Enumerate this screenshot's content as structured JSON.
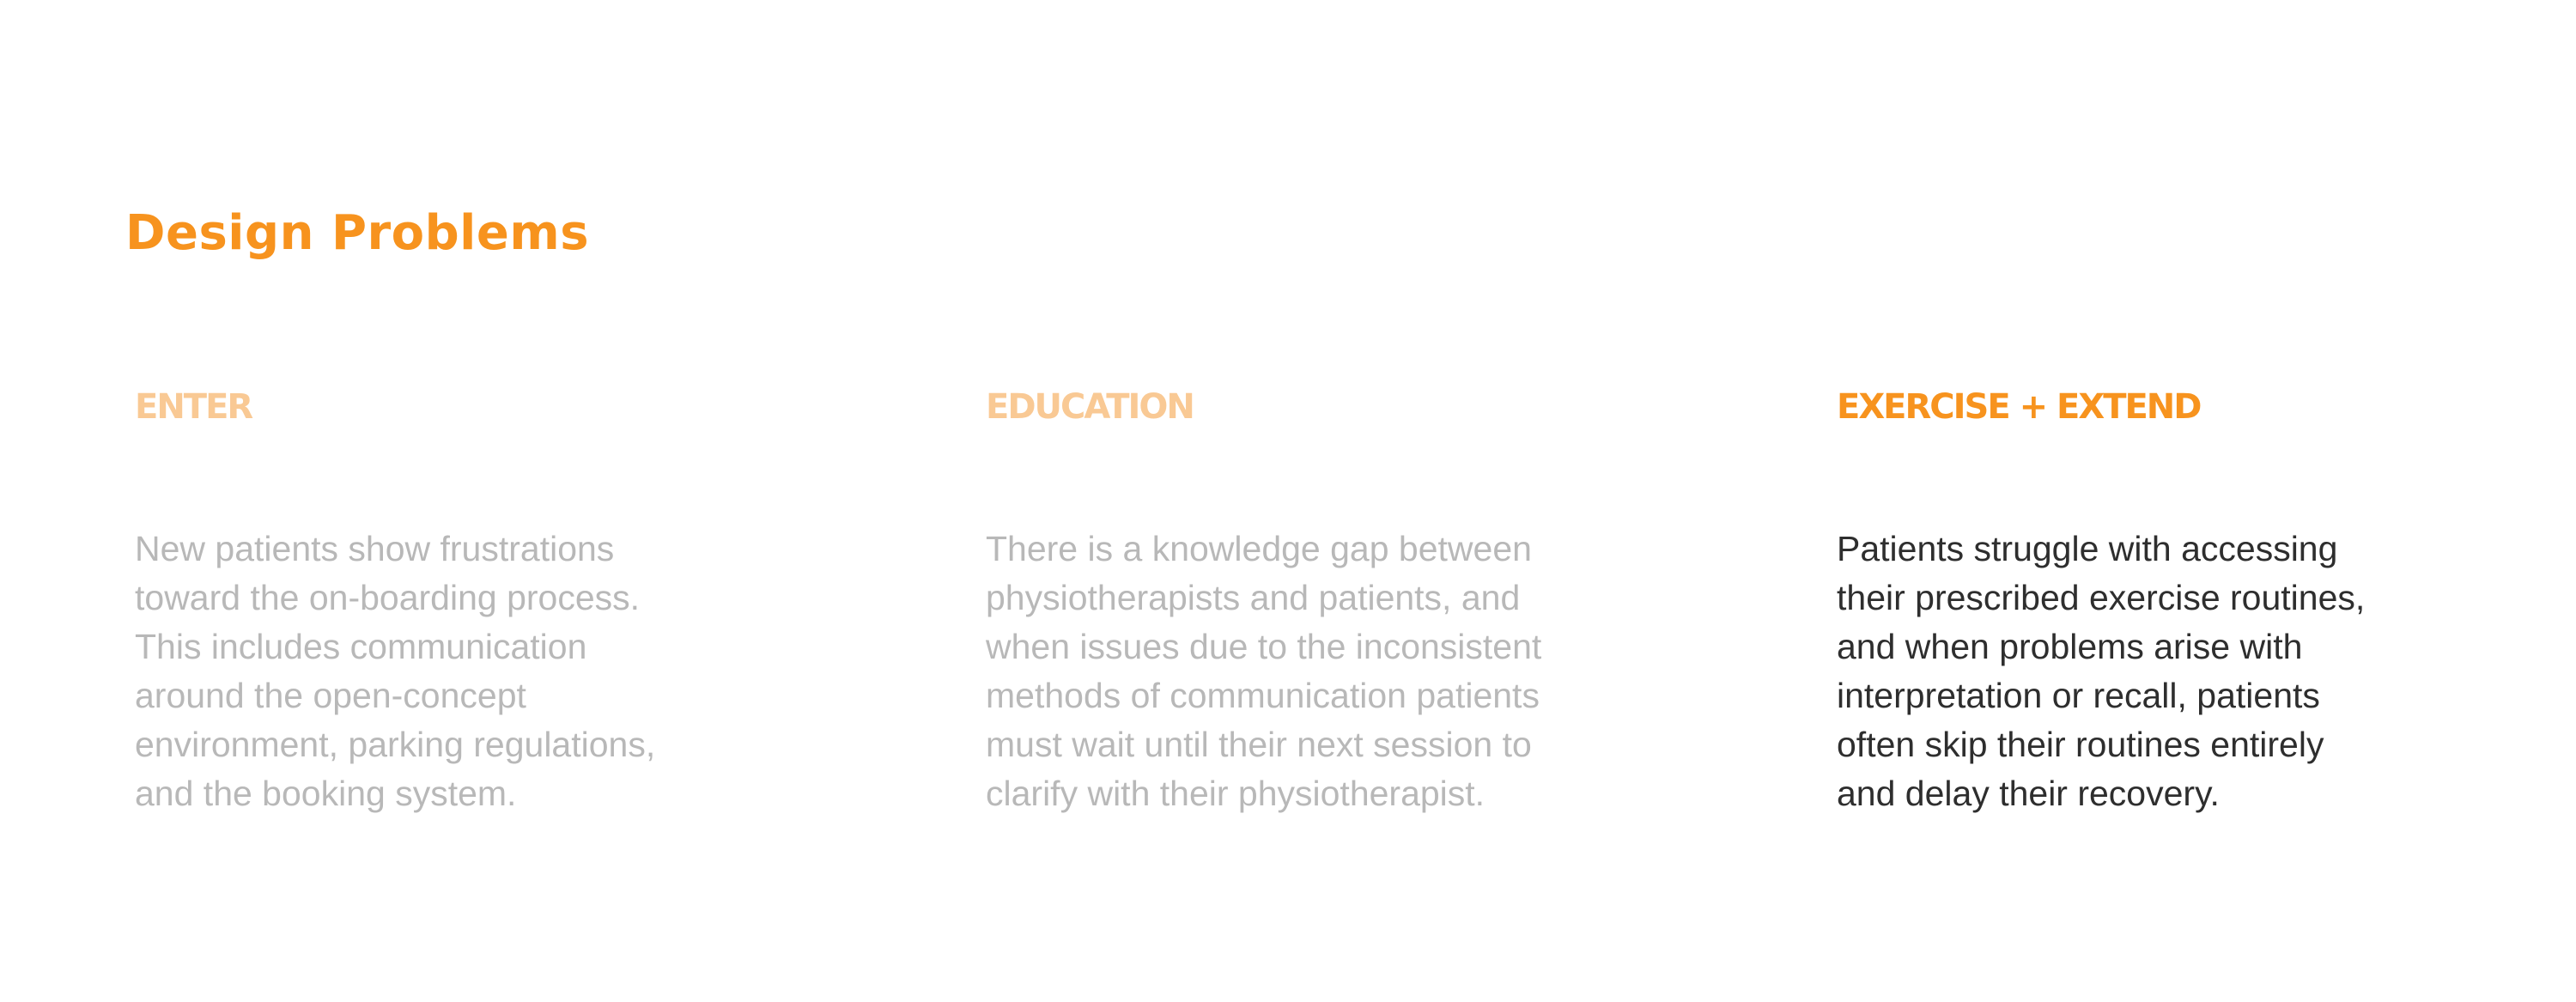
{
  "page": {
    "title": "Design Problems"
  },
  "colors": {
    "accent": "#f7931e",
    "accent_muted": "#f9c994",
    "text_active": "#2e2e2e",
    "text_muted": "#b8b8b8",
    "background": "#ffffff"
  },
  "problems": [
    {
      "heading": "ENTER",
      "state": "muted",
      "lines": [
        "New patients show frustrations",
        "toward the on-boarding process.",
        "This includes communication",
        "around the  open-concept",
        "environment, parking regulations,",
        "and the booking system."
      ]
    },
    {
      "heading": "EDUCATION",
      "state": "muted",
      "lines": [
        "There is a knowledge gap between",
        "physiotherapists and patients, and",
        "when issues due to the inconsistent",
        "methods of communication patients",
        "must wait until their next session to",
        "clarify with their physiotherapist."
      ]
    },
    {
      "heading": "EXERCISE + EXTEND",
      "state": "active",
      "lines": [
        "Patients struggle with accessing",
        "their prescribed exercise routines,",
        "and when problems arise with",
        "interpretation or recall, patients",
        "often skip their routines entirely",
        "and delay their recovery."
      ]
    }
  ]
}
